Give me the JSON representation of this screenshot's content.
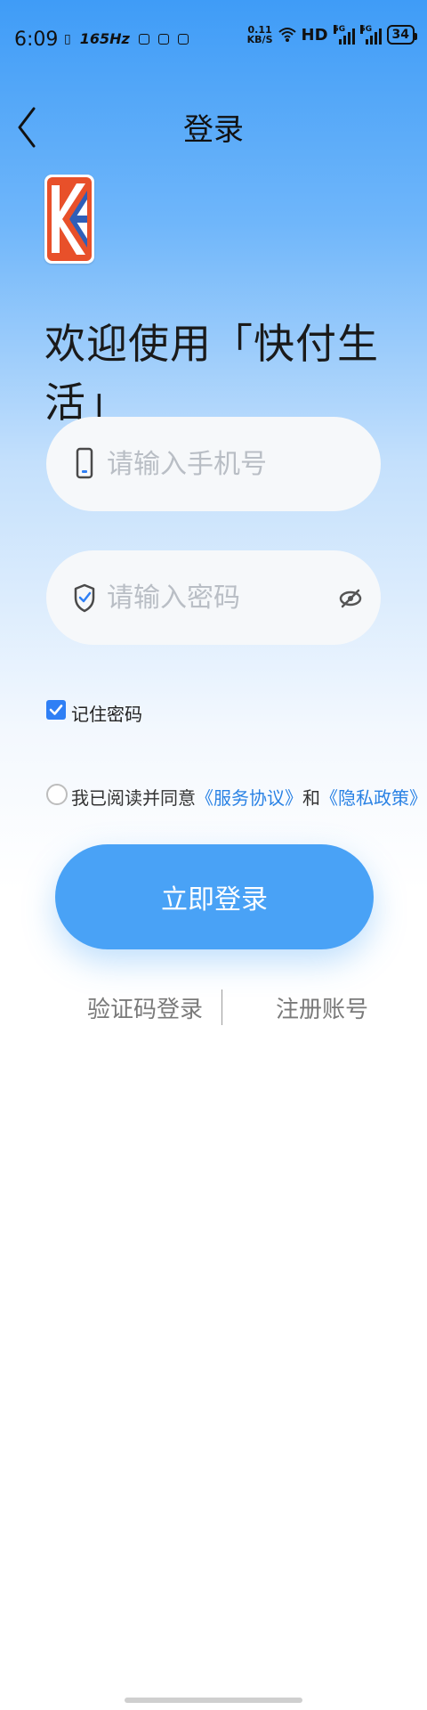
{
  "status_bar": {
    "time": "6:09",
    "refresh_rate": "165Hz",
    "net_speed_value": "0.11",
    "net_speed_unit": "KB/S",
    "hd": "HD",
    "sim1": "5G",
    "sim2": "5G",
    "battery": "34"
  },
  "header": {
    "title": "登录",
    "back_icon": "chevron-left-icon"
  },
  "logo": {
    "brand_colors": [
      "#e8502a",
      "#2f5fb8"
    ]
  },
  "welcome": "欢迎使用「快付生活」",
  "phone_field": {
    "placeholder": "请输入手机号",
    "value": "",
    "icon": "phone-icon"
  },
  "password_field": {
    "placeholder": "请输入密码",
    "value": "",
    "icon": "shield-check-icon",
    "toggle_icon": "eye-off-icon"
  },
  "remember": {
    "label": "记住密码",
    "checked": true
  },
  "agreement": {
    "prefix": "我已阅读并同意",
    "service_link": "《服务协议》",
    "conjunction": "和",
    "privacy_link": "《隐私政策》",
    "checked": false
  },
  "login_button": "立即登录",
  "alt_actions": {
    "sms_login": "验证码登录",
    "register": "注册账号"
  },
  "colors": {
    "accent": "#49a2f6",
    "link": "#2a82e4",
    "checkbox": "#2f7ff5"
  }
}
